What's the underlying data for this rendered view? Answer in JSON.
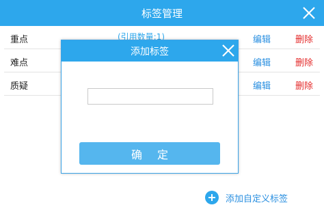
{
  "outer_dialog": {
    "title": "标签管理",
    "close_icon": "close-icon",
    "tags": [
      {
        "name": "重点",
        "count_text": "(引用数量:1)",
        "edit_label": "编辑",
        "delete_label": "删除"
      },
      {
        "name": "难点",
        "count_text": "",
        "edit_label": "编辑",
        "delete_label": "删除"
      },
      {
        "name": "质疑",
        "count_text": "",
        "edit_label": "编辑",
        "delete_label": "删除"
      }
    ],
    "add_custom_label": "添加自定义标签",
    "add_icon": "plus-circle-icon"
  },
  "modal": {
    "title": "添加标签",
    "close_icon": "close-icon",
    "input_value": "",
    "input_placeholder": "",
    "confirm_label": "确定"
  },
  "colors": {
    "header_blue": "#2da7ec",
    "link_blue": "#2a8fe0",
    "delete_red": "#e42b2b",
    "button_blue": "#55b6ee"
  }
}
